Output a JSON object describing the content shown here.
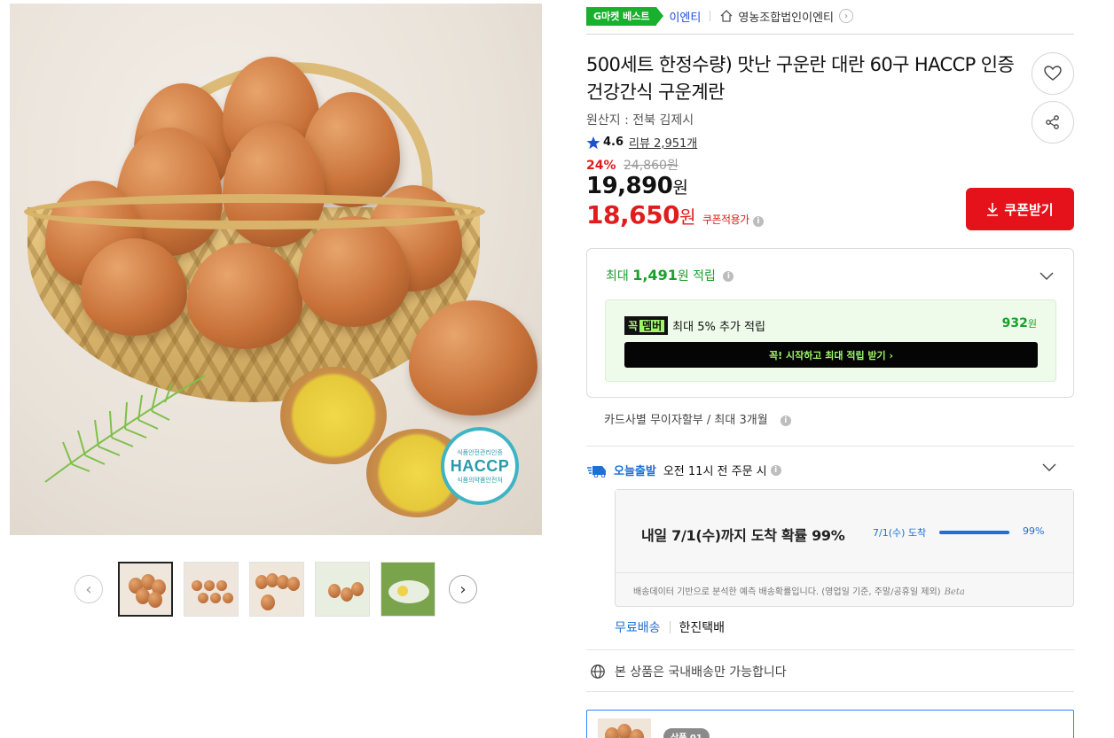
{
  "gallery": {
    "haccp_top": "식품안전관리인증",
    "haccp_mark": "HACCP",
    "haccp_bottom": "식품의약품안전처",
    "prev_icon": "chevron-left-icon",
    "next_icon": "chevron-right-icon",
    "thumbnail_count": 5
  },
  "header": {
    "best_badge": "G마켓 베스트",
    "brand": "이엔티",
    "shop_name": "영농조합법인이엔티",
    "shop_icon": "home-icon"
  },
  "product": {
    "title": "500세트 한정수량) 맛난 구운란 대란 60구 HACCP 인증 건강간식 구운계란",
    "origin": "원산지 : 전북 김제시",
    "rating": "4.6",
    "review_link": "리뷰 2,951개",
    "discount_rate": "24%",
    "original_price": "24,860원",
    "price": "19,890",
    "price_unit": "원",
    "coupon_price": "18,650",
    "coupon_price_unit": "원",
    "coupon_applied": "쿠폰적용가",
    "coupon_button": "쿠폰받기"
  },
  "reward": {
    "head_prefix": "최대 ",
    "head_amount": "1,491",
    "head_suffix": "원 적립",
    "member_tag": "꼭",
    "member_tag_hl": "멤버",
    "member_text": "최대 5% 추가 적립",
    "member_amount": "932",
    "member_unit": "원",
    "member_cta": "꼭! 시작하고 최대 적립 받기  ›"
  },
  "installment": "카드사별 무이자할부 / 최대 3개월",
  "shipping": {
    "today_label": "오늘출발",
    "cutoff": "오전 11시 전 주문 시",
    "arrive_text": "내일 7/1(수)까지 도착 확률 99%",
    "arrive_mini": "7/1(수) 도착",
    "probability": 0.99,
    "probability_label": "99%",
    "note": "배송데이터 기반으로 분석한 예측 배송확률입니다. (영업일 기준, 주말/공휴일 제외)",
    "beta": "Beta",
    "free_shipping": "무료배송",
    "carrier": "한진택배",
    "domestic": "본 상품은 국내배송만 가능합니다"
  },
  "option": {
    "tag": "상품 01"
  },
  "colors": {
    "accent_red": "#e5121b",
    "blue": "#1e6fd6",
    "green": "#19a02a",
    "best_green": "#19b02d"
  }
}
